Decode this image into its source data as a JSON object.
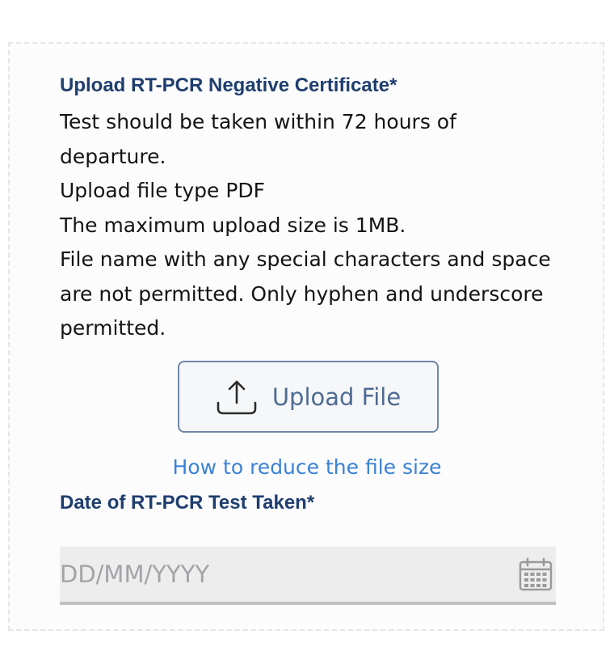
{
  "upload_section": {
    "title": "Upload RT-PCR Negative Certificate*",
    "instructions": [
      "Test should be taken within 72 hours of departure.",
      "Upload file type PDF",
      "The maximum upload size is 1MB.",
      "File name with any special characters and space are not permitted. Only hyphen and underscore permitted."
    ],
    "upload_button": {
      "label": "Upload File",
      "icon": "upload-icon"
    },
    "help_link": "How to reduce the file size"
  },
  "date_section": {
    "title": "Date of RT-PCR Test Taken*",
    "date_input": {
      "value": "",
      "placeholder": "DD/MM/YYYY",
      "icon": "calendar-icon"
    }
  },
  "colors": {
    "heading": "#1f3e6f",
    "body_text": "#141414",
    "button_border": "#6f86a8",
    "button_text": "#4e6b93",
    "link": "#3b82d6",
    "input_background": "#ededee",
    "input_underline": "#bfc0c2",
    "placeholder": "#a4a4a8"
  }
}
